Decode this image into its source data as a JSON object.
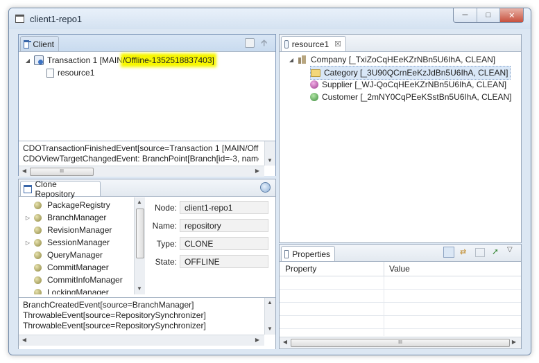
{
  "window": {
    "title": "client1-repo1",
    "buttons": [
      "─",
      "□",
      "✕"
    ]
  },
  "client_view": {
    "tab_label": "Client",
    "tree": {
      "transaction": {
        "prefix": "Transaction 1 [MAIN",
        "highlight": "/Offline-1352518837403]"
      },
      "resource": "resource1"
    },
    "log": [
      "CDOTransactionFinishedEvent[source=Transaction 1 [MAIN/Off",
      "CDOViewTargetChangedEvent: BranchPoint[Branch[id=-3, name"
    ]
  },
  "clone_view": {
    "tab_label": "Clone Repository",
    "items": [
      {
        "label": "PackageRegistry",
        "expandable": false
      },
      {
        "label": "BranchManager",
        "expandable": true
      },
      {
        "label": "RevisionManager",
        "expandable": false
      },
      {
        "label": "SessionManager",
        "expandable": true
      },
      {
        "label": "QueryManager",
        "expandable": false
      },
      {
        "label": "CommitManager",
        "expandable": false
      },
      {
        "label": "CommitInfoManager",
        "expandable": false
      },
      {
        "label": "LockingManager",
        "expandable": false
      }
    ],
    "fields": [
      {
        "label": "Node:",
        "value": "client1-repo1"
      },
      {
        "label": "Name:",
        "value": "repository"
      },
      {
        "label": "Type:",
        "value": "CLONE"
      },
      {
        "label": "State:",
        "value": "OFFLINE"
      }
    ],
    "log": [
      "BranchCreatedEvent[source=BranchManager]",
      "ThrowableEvent[source=RepositorySynchronizer]",
      "ThrowableEvent[source=RepositorySynchronizer]"
    ]
  },
  "resource_editor": {
    "tab_label": "resource1",
    "close_glyph": "☒",
    "root": "Company [_TxiZoCqHEeKZrNBn5U6IhA, CLEAN]",
    "children": [
      {
        "label": "Category [_3U90QCrnEeKzJdBn5U6IhA, CLEAN]",
        "icon": "folder-icon",
        "selected": true
      },
      {
        "label": "Supplier [_WJ-QoCqHEeKZrNBn5U6IhA, CLEAN]",
        "icon": "supplier-icon",
        "selected": false
      },
      {
        "label": "Customer [_2mNY0CqPEeKSstBn5U6IhA, CLEAN]",
        "icon": "customer-icon",
        "selected": false
      }
    ]
  },
  "properties_view": {
    "tab_label": "Properties",
    "columns": [
      "Property",
      "Value"
    ]
  },
  "colors": {
    "highlight": "#f7f700",
    "selection": "#d9e7f7",
    "window_frame": "#dce7f3"
  },
  "scrollbar_glyph": "III"
}
